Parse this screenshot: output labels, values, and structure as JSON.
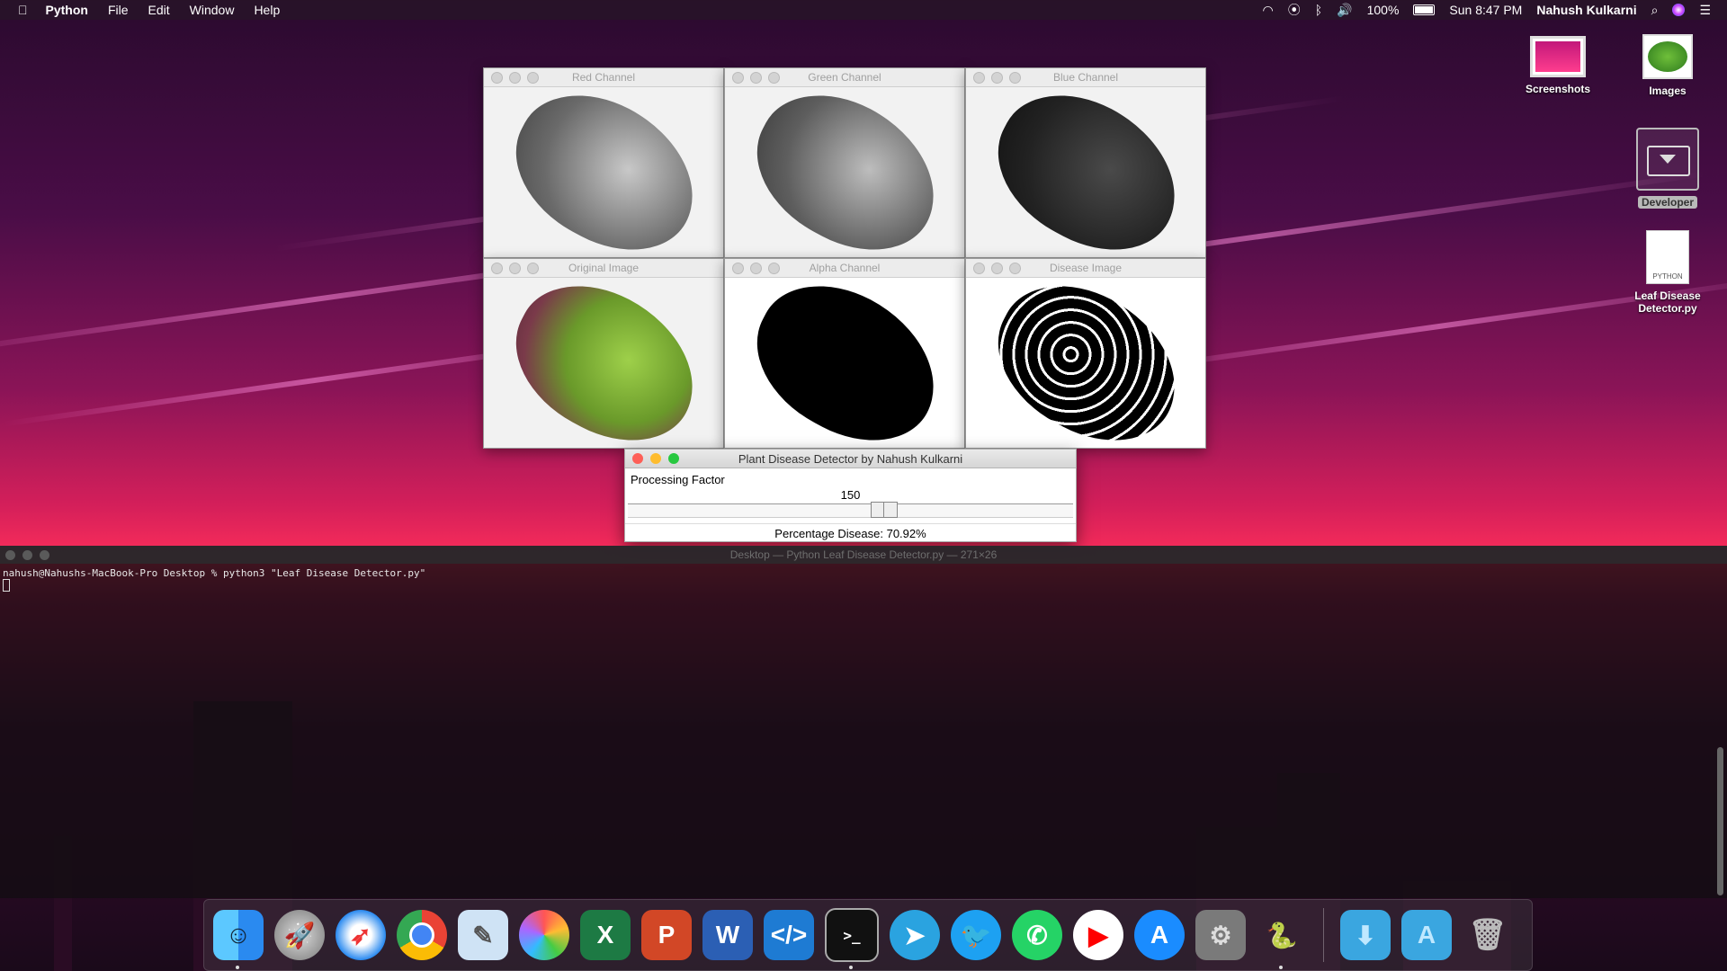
{
  "menubar": {
    "apple": "",
    "app_name": "Python",
    "items": [
      "File",
      "Edit",
      "Window",
      "Help"
    ],
    "battery": "100%",
    "clock": "Sun 8:47 PM",
    "user": "Nahush Kulkarni"
  },
  "desktop_icons": {
    "screenshots": "Screenshots",
    "images": "Images",
    "developer": "Developer",
    "script_name": "Leaf Disease Detector.py",
    "script_badge": "PYTHON"
  },
  "image_windows": {
    "red": "Red Channel",
    "green": "Green Channel",
    "blue": "Blue Channel",
    "original": "Original Image",
    "alpha": "Alpha Channel",
    "disease": "Disease Image"
  },
  "dialog": {
    "title": "Plant Disease Detector by Nahush Kulkarni",
    "slider_label": "Processing Factor",
    "slider_value": "150",
    "slider_fraction": 0.58,
    "percentage": "Percentage Disease: 70.92%"
  },
  "terminal": {
    "title": "Desktop — Python Leaf Disease Detector.py — 271×26",
    "command": "nahush@Nahushs-MacBook-Pro Desktop % python3 \"Leaf Disease Detector.py\""
  },
  "dock": {
    "apps": [
      "finder",
      "launchpad",
      "safari",
      "chrome",
      "preview",
      "photos",
      "excel",
      "powerpoint",
      "word",
      "vscode",
      "terminal",
      "telegram",
      "twitter",
      "whatsapp",
      "youtube",
      "app-store",
      "system-preferences",
      "python-launcher"
    ],
    "folders": [
      "downloads-folder",
      "applications-folder",
      "trash"
    ]
  },
  "colors": {
    "close": "#fe5f57",
    "minimize": "#febc2e",
    "zoom": "#28c840"
  }
}
